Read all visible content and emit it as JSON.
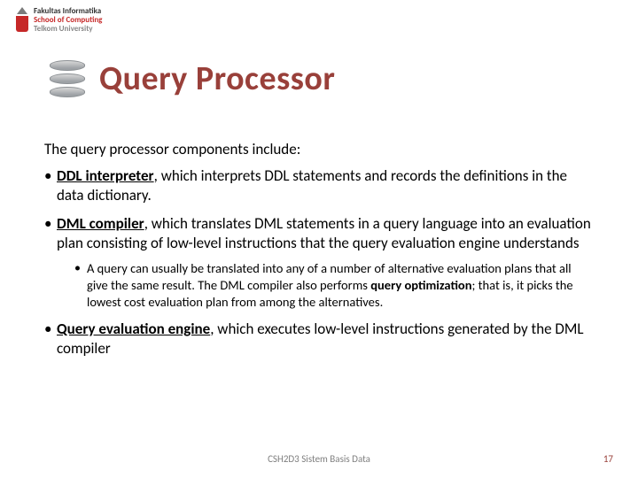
{
  "logo": {
    "line1": "Fakultas Informatika",
    "line2": "School of Computing",
    "line3": "Telkom University"
  },
  "title": "Query Processor",
  "intro": "The query processor components include:",
  "bullets": {
    "b1_term": "DDL interpreter",
    "b1_rest": ", which interprets DDL statements and records the definitions in the data dictionary.",
    "b2_term": "DML compiler",
    "b2_rest": ", which translates DML statements in a query language into an evaluation plan consisting of low-level instructions that the query evaluation engine understands",
    "b2_sub_pre": "A query can usually be translated into any of a number of alternative evaluation plans that all give the same result. The DML compiler also performs ",
    "b2_sub_bold": "query optimization",
    "b2_sub_post": "; that is, it picks the lowest cost evaluation plan from among the alternatives.",
    "b3_term": "Query evaluation engine",
    "b3_rest": ", which executes low-level instructions generated by the DML compiler"
  },
  "footer": {
    "course": "CSH2D3 Sistem Basis Data",
    "page": "17"
  }
}
